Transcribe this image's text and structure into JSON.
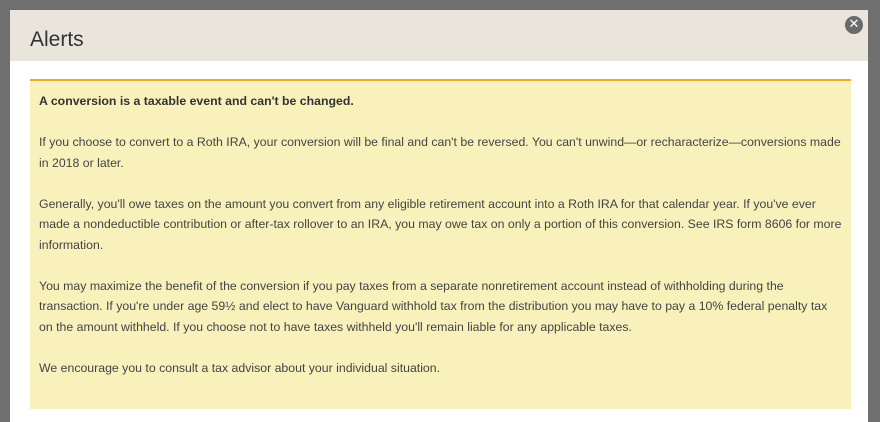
{
  "dialog": {
    "title": "Alerts",
    "close_glyph": "✕",
    "close_icon": "close-icon"
  },
  "alert": {
    "heading": "A conversion is a taxable event and can't be changed.",
    "paragraphs": [
      "If you choose to convert to a Roth IRA, your conversion will be final and can't be reversed. You can't unwind—or recharacterize—conversions made in 2018 or later.",
      "Generally, you'll owe taxes on the amount you convert from any eligible retirement account into a Roth IRA for that calendar year. If you've ever made a nondeductible contribution or after-tax rollover to an IRA, you may owe tax on only a portion of this conversion. See IRS form 8606 for more information.",
      "You may maximize the benefit of the conversion if you pay taxes from a separate nonretirement account instead of withholding during the transaction. If you're under age 59½ and elect to have Vanguard withhold tax from the distribution you may have to pay a 10% federal penalty tax on the amount withheld. If you choose not to have taxes withheld you'll remain liable for any applicable taxes.",
      "We encourage you to consult a tax advisor about your individual situation."
    ]
  },
  "colors": {
    "overlay": "#6f6f6f",
    "header_bg": "#e9e5dc",
    "alert_bg": "#f8f1bb",
    "alert_border": "#e8ad2a",
    "close_bg": "#6a6a6a"
  }
}
